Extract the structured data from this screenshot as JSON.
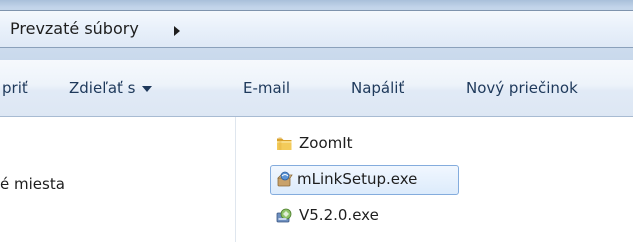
{
  "address_bar": {
    "path_segment": "Prevzaté súbory"
  },
  "toolbar": {
    "organize_label": "priť",
    "share_label": "Zdieľať s",
    "email_label": "E-mail",
    "burn_label": "Napáliť",
    "new_folder_label": "Nový priečinok"
  },
  "navigation": {
    "items": [
      {
        "label": "é miesta"
      }
    ]
  },
  "files": {
    "items": [
      {
        "name": "ZoomIt",
        "icon": "folder-icon",
        "selected": false
      },
      {
        "name": "mLinkSetup.exe",
        "icon": "installer-icon",
        "selected": true
      },
      {
        "name": "V5.2.0.exe",
        "icon": "application-icon",
        "selected": false
      }
    ]
  },
  "colors": {
    "toolbar_text": "#1e395b",
    "selection_border": "#84acdd",
    "folder": "#e8b642"
  }
}
